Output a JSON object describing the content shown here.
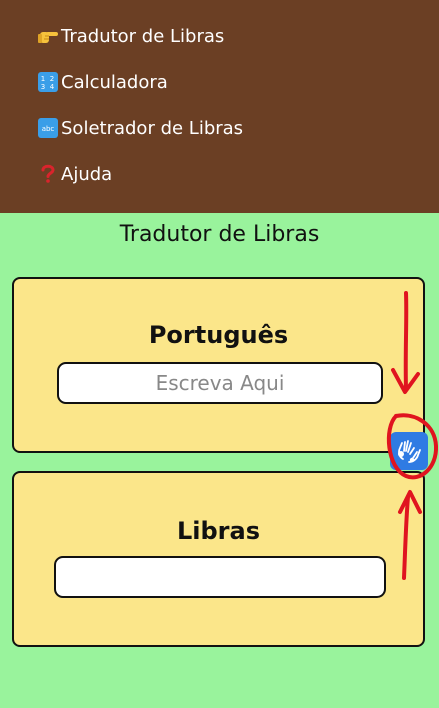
{
  "nav": {
    "items": [
      {
        "icon": "point-right-icon",
        "label": "Tradutor de Libras"
      },
      {
        "icon": "numbers-icon",
        "label": "Calculadora"
      },
      {
        "icon": "letters-icon",
        "label": "Soletrador de Libras"
      },
      {
        "icon": "question-icon",
        "label": "Ajuda"
      }
    ]
  },
  "page": {
    "title": "Tradutor de Libras"
  },
  "portugues_panel": {
    "title": "Português",
    "input_placeholder": "Escreva Aqui",
    "input_value": ""
  },
  "libras_panel": {
    "title": "Libras",
    "output_value": ""
  },
  "libras_button": {
    "icon": "hands-sign-icon"
  },
  "colors": {
    "nav_background": "#6b3f24",
    "page_background": "#99f39c",
    "panel_background": "#fbe68a",
    "button_background": "#2f7be3",
    "annotation_red": "#e0141f"
  }
}
